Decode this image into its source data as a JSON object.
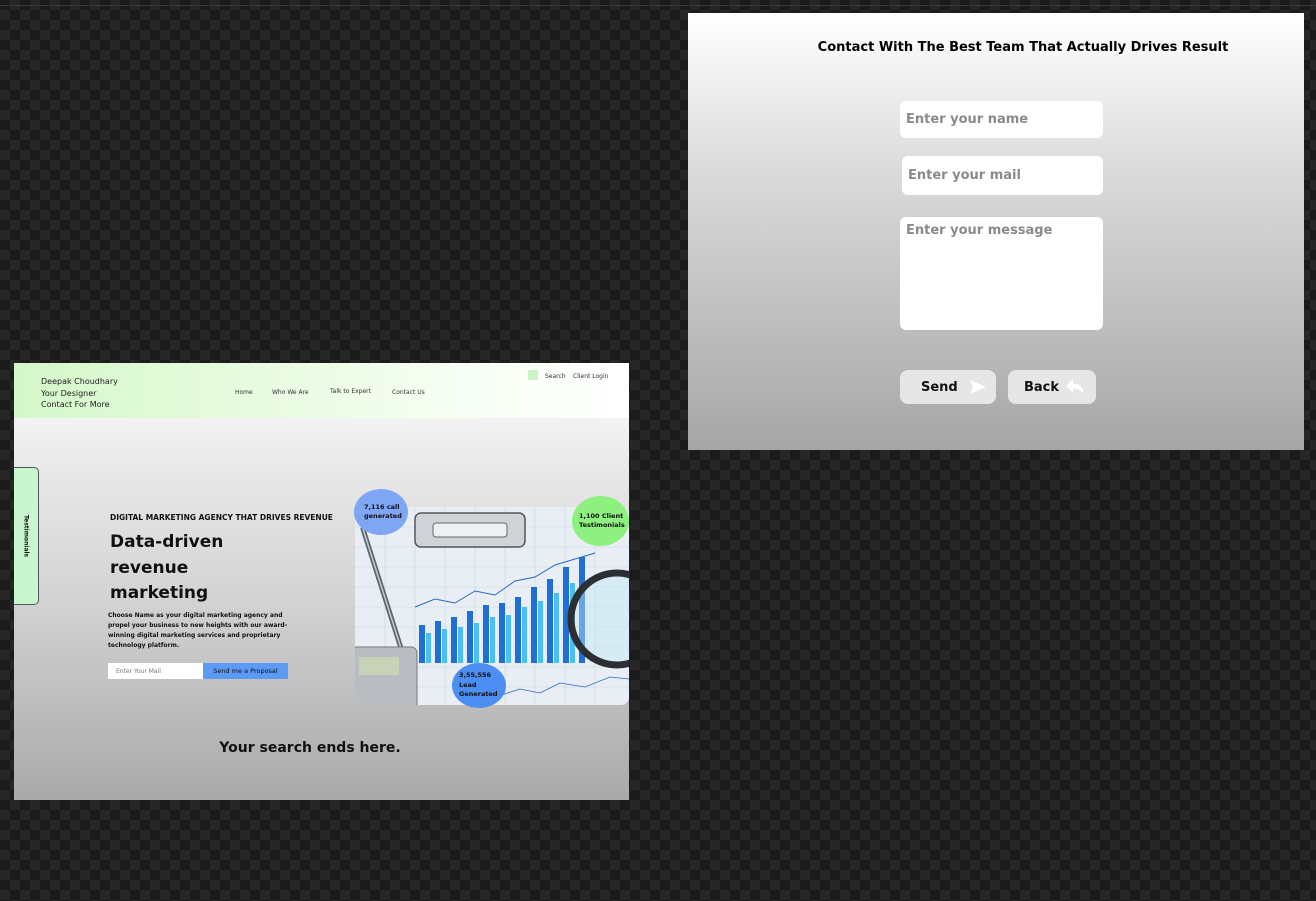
{
  "contact": {
    "title": "Contact With The Best Team That Actually Drives Result",
    "name_placeholder": "Enter your name",
    "mail_placeholder": "Enter your mail",
    "message_placeholder": "Enter your message",
    "send_label": "Send",
    "back_label": "Back"
  },
  "site": {
    "brand": {
      "line1": "Deepak Choudhary",
      "line2": "Your Designer",
      "line3": "Contact For More"
    },
    "nav": [
      "Home",
      "Who We Are",
      "Talk to Expert",
      "Contact Us"
    ],
    "top_links": {
      "search": "Search",
      "client_login": "Client Login"
    },
    "side_tab": "Testimonials",
    "hero": {
      "eyebrow": "DIGITAL MARKETING AGENCY THAT DRIVES REVENUE",
      "headline": [
        "Data-driven",
        "revenue",
        "marketing"
      ],
      "description": "Choose Name as your digital marketing agency and propel your business to new heights with our award-winning digital marketing services and proprietary technology platform.",
      "mail_placeholder": "Enter Your Mail",
      "cta_label": "Send me a Proposal"
    },
    "stats": {
      "calls": [
        "7,116 call",
        "generated"
      ],
      "testimonials": [
        "1,100 Client",
        "Testimonials"
      ],
      "leads": [
        "3,55,556",
        "Lead",
        "Generated"
      ]
    },
    "tagline": "Your search ends here."
  },
  "colors": {
    "header_green": "#d4f8c9",
    "side_tab": "#c9f5cf",
    "cta_blue": "#5b9af5",
    "bubble_blue": "#7fa6f4",
    "bubble_green": "#8df07f",
    "bubble_dark_blue": "#4d8ef3"
  }
}
